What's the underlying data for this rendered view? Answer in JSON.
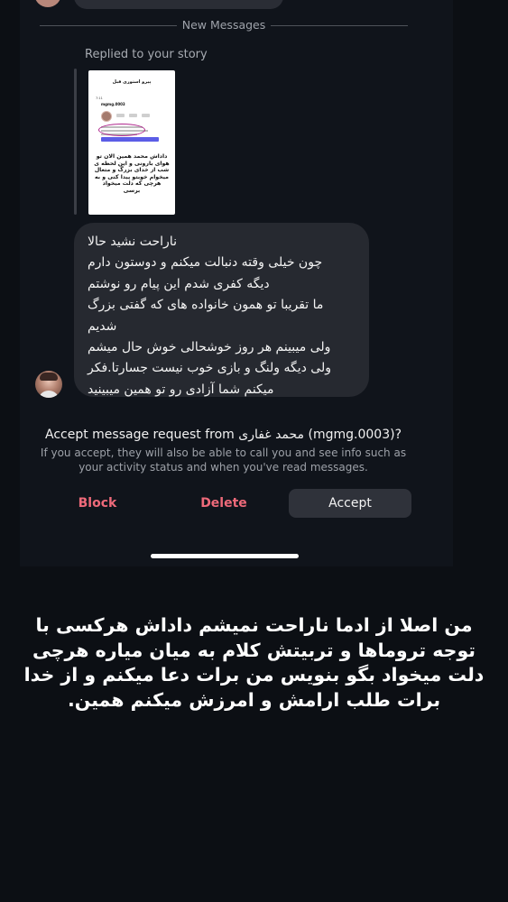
{
  "divider": {
    "label": "New Messages"
  },
  "reply": {
    "label": "Replied to your story"
  },
  "story_preview": {
    "title": "پیرو استوری قبل",
    "status_time": "7:11",
    "handle": "mgmg.0003",
    "caption_lines": [
      "داداش محمد همین الان تو",
      "هوای بارونی و این لحظه ی",
      "شب از خدای بزرگ و متعال",
      "میخوام خوبتو پیدا کنی و به",
      "هرچی که دلت میخواد برسی"
    ]
  },
  "message": {
    "lines": [
      "ناراحت نشید حالا",
      "چون خیلی وقته دنبالت میکنم و دوستون دارم",
      "دیگه کفری شدم این پیام رو نوشتم",
      "ما تقریبا تو همون خانواده های که گفتی بزرگ",
      "شدیم",
      "ولی میبینم هر روز خوشحالی خوش حال میشم",
      "ولی دیگه ولنگ و بازی خوب نیست جسارتا.فکر",
      "میکنم شما آزادی رو تو همین میبینید"
    ]
  },
  "request": {
    "prefix": "Accept message request from",
    "name": "محمد غفاری",
    "username": "(mgmg.0003)?",
    "description": "If you accept, they will also be able to call you and see info such as your activity status and when you've read messages."
  },
  "actions": {
    "block": "Block",
    "delete": "Delete",
    "accept": "Accept"
  },
  "overlay": {
    "lines": [
      "من اصلا از ادما ناراحت نمیشم داداش هرکسی با",
      "توجه تروماها و تربیتش کلام به میان میاره هرچی",
      "دلت میخواد بگو بنویس من برات دعا میکنم و از خدا",
      "برات  طلب ارامش و امرزش میکنم همین."
    ]
  },
  "colors": {
    "background": "#0c0f14",
    "bubble": "#262930",
    "danger": "#ee6a7a",
    "accept_button": "#2f323a"
  }
}
